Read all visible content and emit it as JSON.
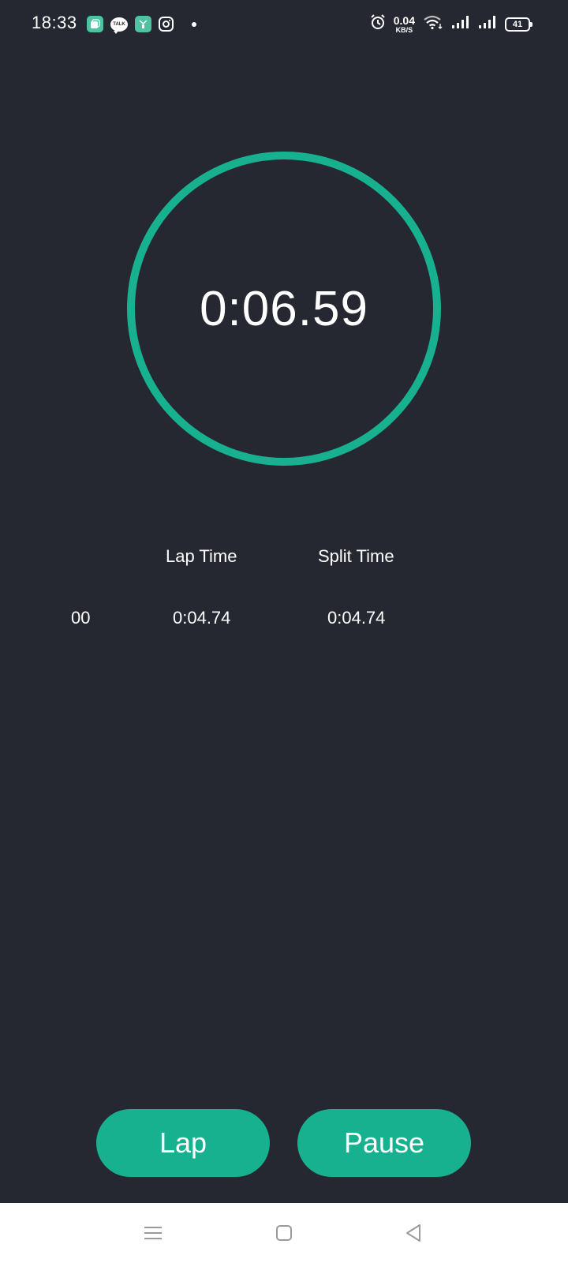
{
  "status_bar": {
    "time": "18:33",
    "notification_icons": [
      "app-tile-icon",
      "kakaotalk-icon",
      "app-tile-icon",
      "instagram-icon",
      "dot-icon"
    ],
    "talk_label": "TALK",
    "net_speed_value": "0.04",
    "net_speed_unit": "KB/S",
    "battery_level": "41",
    "system_icons": [
      "alarm-icon",
      "wifi-icon",
      "signal-icon",
      "signal-icon",
      "battery-icon"
    ]
  },
  "stopwatch": {
    "elapsed": "0:06.59",
    "ring_color": "#18b18f"
  },
  "laps": {
    "headers": {
      "lap_time": "Lap Time",
      "split_time": "Split Time"
    },
    "rows": [
      {
        "number": "00",
        "lap_time": "0:04.74",
        "split_time": "0:04.74"
      }
    ]
  },
  "controls": {
    "lap_label": "Lap",
    "pause_label": "Pause",
    "button_color": "#18b18f"
  },
  "nav_bar": {
    "icons": [
      "menu-icon",
      "home-icon",
      "back-icon"
    ]
  },
  "theme": {
    "background": "#252830",
    "text": "#ffffff"
  }
}
